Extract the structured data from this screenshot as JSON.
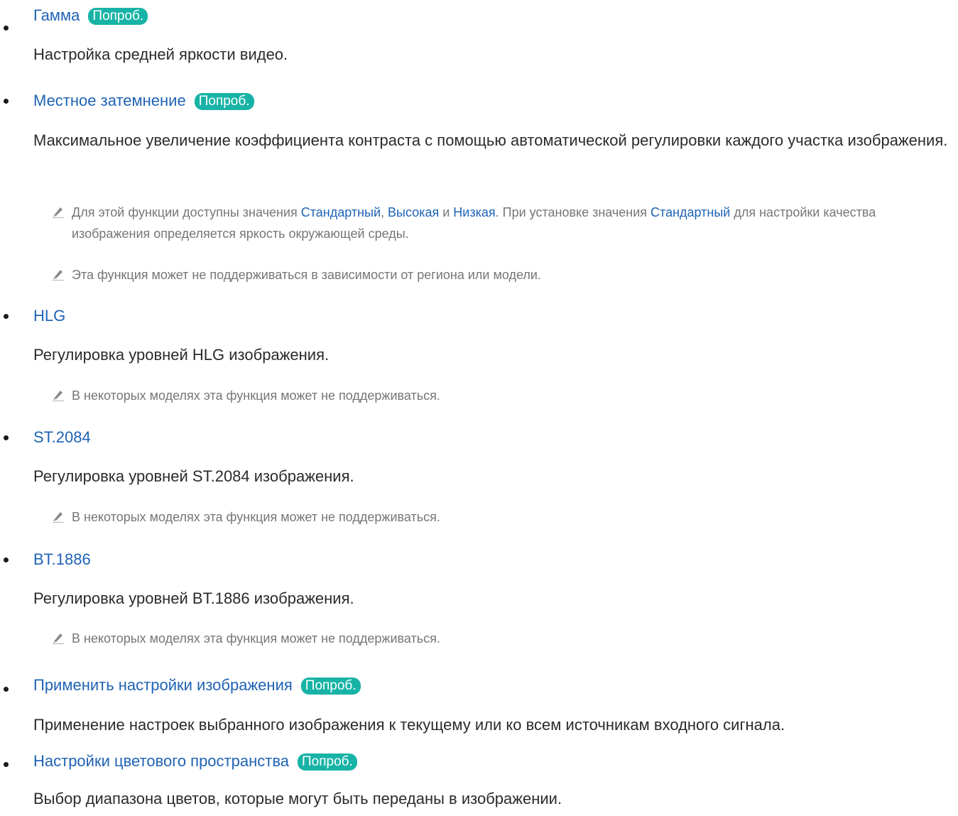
{
  "try_label": "Попроб.",
  "items": [
    {
      "title": "Гамма",
      "desc": "Настройка средней яркости видео."
    },
    {
      "title": "Местное затемнение",
      "desc": "Максимальное увеличение коэффициента контраста с помощью автоматической регулировки каждого участка изображения.",
      "note1": {
        "t1": "Для этой функции доступны значения ",
        "h1": "Стандартный",
        "t2": ", ",
        "h2": "Высокая",
        "t3": " и ",
        "h3": "Низкая",
        "t4": ". При установке значения ",
        "h4": "Стандартный",
        "t5": " для настройки качества изображения определяется яркость окружающей среды."
      },
      "note2": "Эта функция может не поддерживаться в зависимости от региона или модели."
    },
    {
      "title": "HLG",
      "desc": "Регулировка уровней HLG изображения.",
      "note": "В некоторых моделях эта функция может не поддерживаться."
    },
    {
      "title": "ST.2084",
      "desc": "Регулировка уровней ST.2084 изображения.",
      "note": "В некоторых моделях эта функция может не поддерживаться."
    },
    {
      "title": "BT.1886",
      "desc": "Регулировка уровней BT.1886 изображения.",
      "note": "В некоторых моделях эта функция может не поддерживаться."
    },
    {
      "title": "Применить настройки изображения",
      "desc": "Применение настроек выбранного изображения к текущему или ко всем источникам входного сигнала."
    },
    {
      "title": "Настройки цветового пространства",
      "desc": "Выбор диапазона цветов, которые могут быть переданы в изображении."
    }
  ],
  "colors": {
    "link": "#1f63b5",
    "try_badge": "#17b3a6",
    "note_text": "#767676",
    "body_text": "#2b2b2b"
  },
  "icons": {
    "note": "pencil-note-icon"
  }
}
